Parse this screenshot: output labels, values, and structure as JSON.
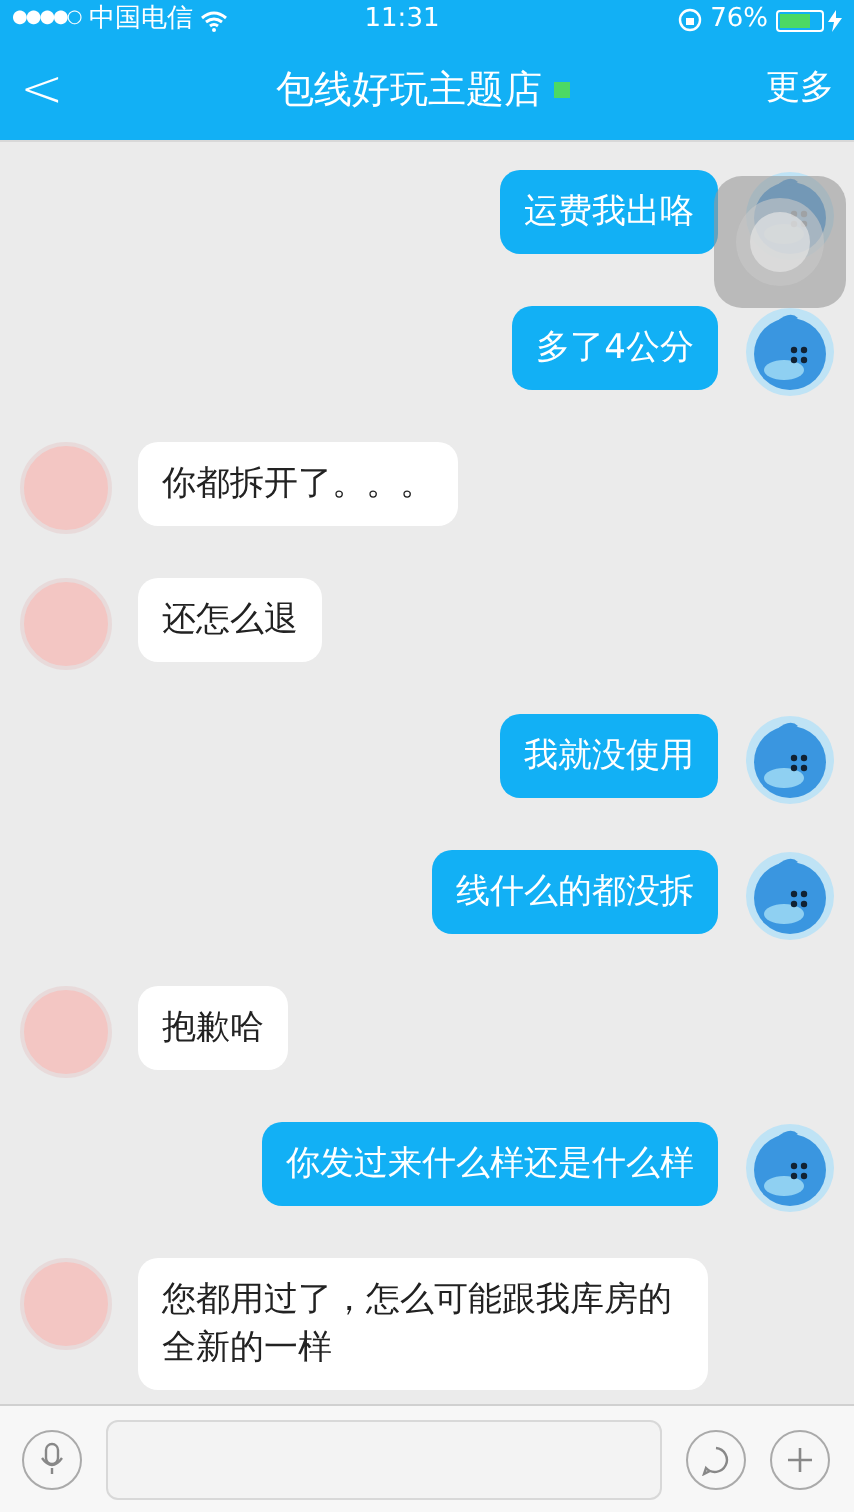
{
  "status_bar": {
    "signal": "●●●●○",
    "carrier": "中国电信",
    "time": "11:31",
    "battery_text": "76%",
    "battery": {
      "level": 0.76,
      "charging": true
    }
  },
  "nav_bar": {
    "back": "<",
    "title": "包线好玩主题店",
    "online": true,
    "more": "更多"
  },
  "messages": [
    {
      "kind": "outgoing",
      "text": "运费我出咯"
    },
    {
      "kind": "outgoing",
      "text": "多了4公分"
    },
    {
      "kind": "incoming",
      "text": "你都拆开了。。。"
    },
    {
      "kind": "incoming",
      "text": "还怎么退"
    },
    {
      "kind": "outgoing",
      "text": "我就没使用"
    },
    {
      "kind": "outgoing",
      "text": "线什么的都没拆"
    },
    {
      "kind": "incoming",
      "text": "抱歉哈"
    },
    {
      "kind": "outgoing",
      "text": "你发过来什么样还是什么样"
    },
    {
      "kind": "incoming",
      "text": "您都用过了，怎么可能跟我库房的全新的一样"
    }
  ],
  "input_bar": {
    "show_assistive_touch": true
  }
}
